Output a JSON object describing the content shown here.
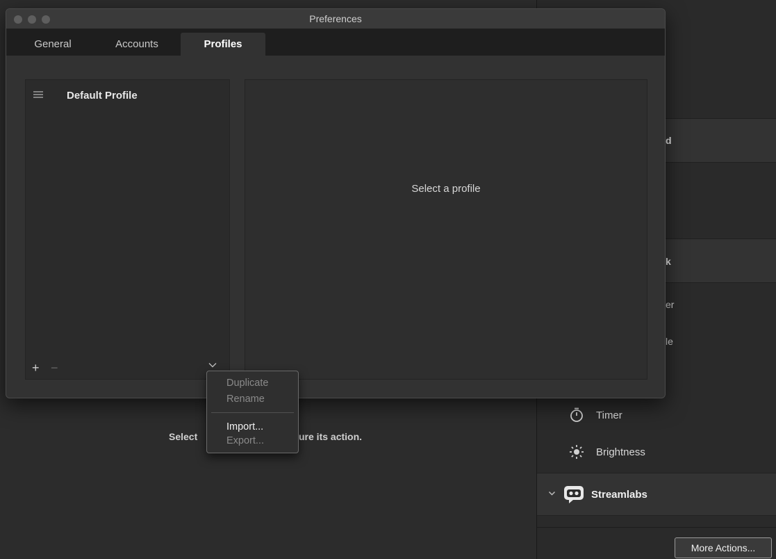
{
  "window": {
    "title": "Preferences",
    "tabs": [
      {
        "label": "General",
        "active": false
      },
      {
        "label": "Accounts",
        "active": false
      },
      {
        "label": "Profiles",
        "active": true
      }
    ]
  },
  "profiles": {
    "items": [
      {
        "name": "Default Profile"
      }
    ],
    "add_label": "+",
    "remove_label": "−",
    "placeholder": "Select a profile"
  },
  "context_menu": {
    "items": [
      {
        "label": "Duplicate",
        "enabled": false
      },
      {
        "label": "Rename",
        "enabled": false
      },
      {
        "label": "Import...",
        "enabled": true
      },
      {
        "label": "Export...",
        "enabled": false
      }
    ]
  },
  "background": {
    "hint_left": "Select",
    "hint_right": "ure its action.",
    "sidebar_fragments": [
      "d",
      "k",
      "er",
      "le"
    ],
    "actions": [
      {
        "label": "Timer",
        "icon": "timer-icon"
      },
      {
        "label": "Brightness",
        "icon": "brightness-icon"
      }
    ],
    "plugin_group": {
      "label": "Streamlabs",
      "icon": "streamlabs-icon"
    },
    "more_actions_label": "More Actions..."
  },
  "colors": {
    "window_bg": "#323232",
    "tab_bar_bg": "#1e1e1e",
    "panel_bg": "#2b2b2b",
    "text": "#d8d8d8"
  }
}
